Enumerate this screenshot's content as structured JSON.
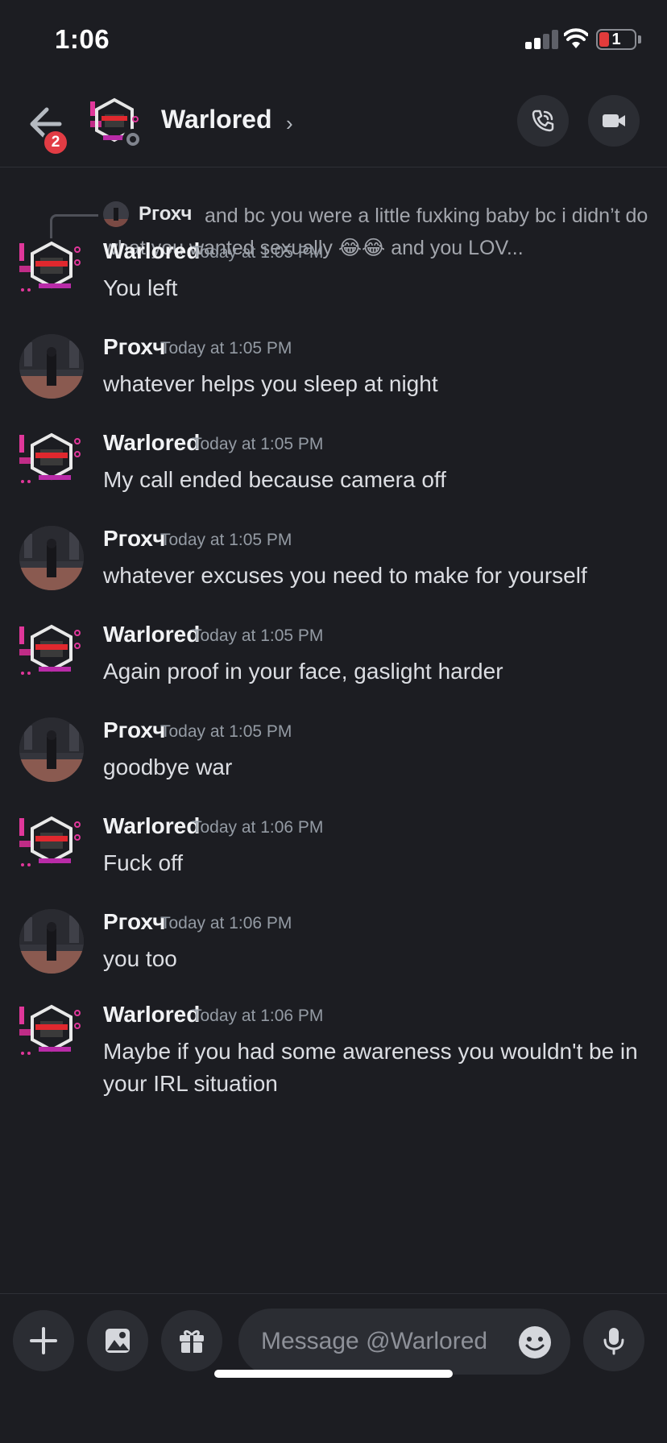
{
  "status_bar": {
    "time": "1:06",
    "battery": "1"
  },
  "header": {
    "back_badge": "2",
    "dm_name": "Warlored",
    "chevron": "›"
  },
  "reply_preview": {
    "author": "Ргохч",
    "text": "and bc you were a little fuxking baby bc i didn’t do what you wanted sexually 😂😂 and you LOV..."
  },
  "messages": [
    {
      "author": "Warlored",
      "time": "Today at 1:05 PM",
      "text": "You left"
    },
    {
      "author": "Ргохч",
      "time": "Today at 1:05 PM",
      "text": "whatever helps you sleep at night"
    },
    {
      "author": "Warlored",
      "time": "Today at 1:05 PM",
      "text": "My call ended because camera off"
    },
    {
      "author": "Ргохч",
      "time": "Today at 1:05 PM",
      "text": "whatever excuses you need to make for yourself"
    },
    {
      "author": "Warlored",
      "time": "Today at 1:05 PM",
      "text": "Again proof in your face, gaslight harder"
    },
    {
      "author": "Ргохч",
      "time": "Today at 1:05 PM",
      "text": "goodbye war"
    },
    {
      "author": "Warlored",
      "time": "Today at 1:06 PM",
      "text": "Fuck off"
    },
    {
      "author": "Ргохч",
      "time": "Today at 1:06 PM",
      "text": "you too"
    },
    {
      "author": "Warlored",
      "time": "Today at 1:06 PM",
      "text": "Maybe if you had some awareness you wouldn't be in your IRL situation"
    }
  ],
  "composer": {
    "placeholder": "Message @Warlored"
  },
  "icons": {
    "back": "back-arrow-icon",
    "call": "phone-call-icon",
    "video": "video-camera-icon",
    "plus": "plus-icon",
    "gallery": "image-gallery-icon",
    "gift": "gift-icon",
    "emoji": "emoji-smile-icon",
    "mic": "microphone-icon"
  },
  "colors": {
    "background": "#1c1d22",
    "button_bg": "#2b2d33",
    "badge_red": "#e23c44",
    "accent_pink": "#e0379a"
  }
}
